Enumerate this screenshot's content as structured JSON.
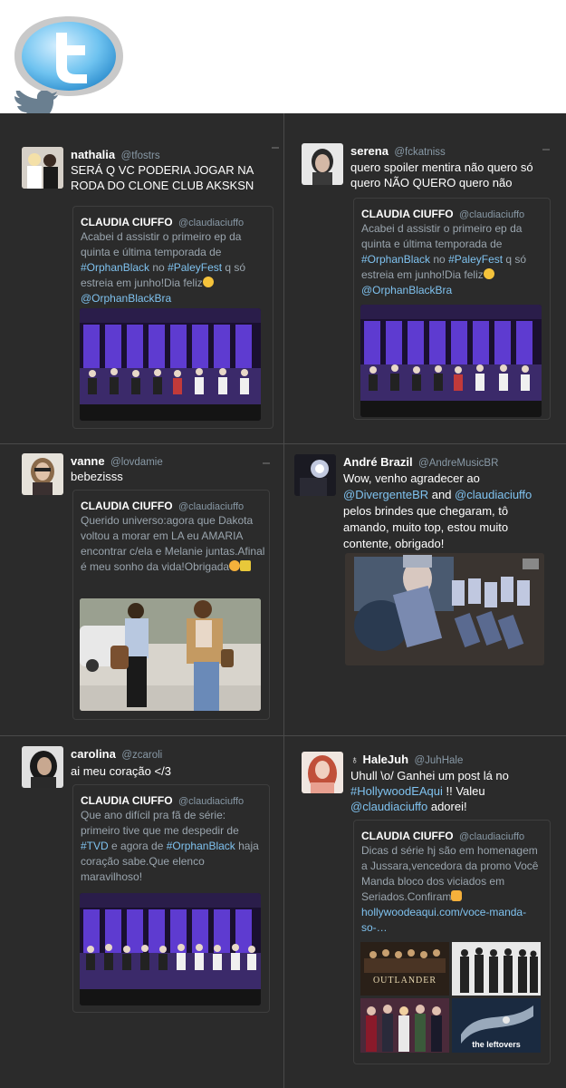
{
  "tweets": [
    {
      "name": "nathalia",
      "handle": "@tfostrs",
      "text": "SERÁ Q VC PODERIA JOGAR NA RODA DO CLONE CLUB AKSKSN",
      "quote": {
        "name": "CLAUDIA CIUFFO",
        "handle": "@claudiaciuffo",
        "p1": "Acabei d assistir o primeiro ep da quinta e última temporada de ",
        "h1": "#OrphanBlack",
        "p2": " no ",
        "h2": "#PaleyFest",
        "p3": " q só estreia em junho!Dia feliz",
        "h3": "@OrphanBlackBra"
      }
    },
    {
      "name": "serena",
      "handle": "@fckatniss",
      "text": "quero spoiler mentira não quero só quero NÃO QUERO quero não",
      "quote": {
        "name": "CLAUDIA CIUFFO",
        "handle": "@claudiaciuffo",
        "p1": "Acabei d assistir o primeiro ep da quinta e última temporada de ",
        "h1": "#OrphanBlack",
        "p2": " no ",
        "h2": "#PaleyFest",
        "p3": " q só estreia em junho!Dia feliz",
        "h3": "@OrphanBlackBra"
      }
    },
    {
      "name": "vanne",
      "handle": "@lovdamie",
      "text": "bebezisss",
      "quote": {
        "name": "CLAUDIA CIUFFO",
        "handle": "@claudiaciuffo",
        "p1": "Querido universo:agora que Dakota voltou a morar em LA eu AMARIA encontrar c/ela e Melanie juntas.Afinal é meu sonho da vida!Obrigada"
      }
    },
    {
      "name": "André Brazil",
      "handle": "@AndreMusicBR",
      "p1": "Wow, venho agradecer ao ",
      "h1": "@DivergenteBR",
      "p2": " and ",
      "h2": "@claudiaciuffo",
      "p3": " pelos brindes que chegaram, tô amando, muito top, estou muito contente, obrigado!"
    },
    {
      "name": "carolina",
      "handle": "@zcaroli",
      "text": "ai meu coração </3",
      "quote": {
        "name": "CLAUDIA CIUFFO",
        "handle": "@claudiaciuffo",
        "p1": "Que ano difícil pra fã de série: primeiro tive que me despedir de ",
        "h1": "#TVD",
        "p2": " e agora de ",
        "h2": "#OrphanBlack",
        "p3": " haja coração sabe.Que elenco maravilhoso!"
      }
    },
    {
      "name": "HaleJuh",
      "handle": "@JuhHale",
      "p1": "Uhull \\o/ Ganhei um post lá no ",
      "h1": "#HollywoodEAqui",
      "p2": " !! Valeu ",
      "h2": "@claudiaciuffo",
      "p3": " adorei!",
      "quote": {
        "name": "CLAUDIA CIUFFO",
        "handle": "@claudiaciuffo",
        "p1": "Dicas d série hj são em homenagem a Jussara,vencedora da promo Você Manda bloco dos viciados em Seriados.Confiram",
        "link": "hollywoodeaqui.com/voce-manda-so-…",
        "media_labels": [
          "OUTLANDER",
          "the leftovers"
        ]
      }
    }
  ],
  "colors": {
    "background": "#2b2b2b",
    "link": "#7fc2ef",
    "name": "#ffffff",
    "handle": "#8899a6",
    "quote_text": "#9aa5ae",
    "twitter_blue": "#55acee"
  }
}
